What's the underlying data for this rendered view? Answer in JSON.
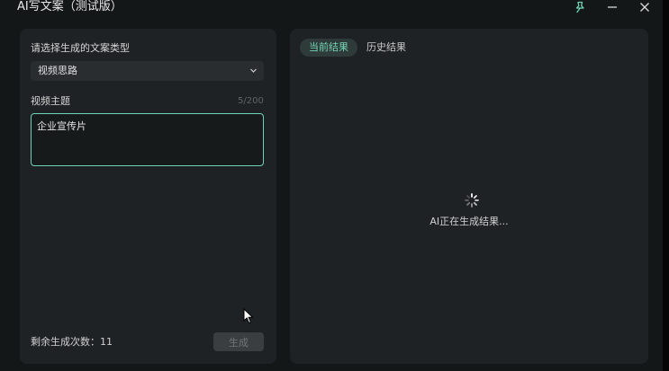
{
  "window": {
    "title": "AI写文案（测试版）"
  },
  "titlebar": {
    "pin_icon": "pin-icon",
    "minimize_icon": "minimize-icon",
    "close_icon": "close-icon"
  },
  "form": {
    "type_label": "请选择生成的文案类型",
    "type_selected": "视频思路",
    "topic_label": "视频主题",
    "topic_counter": "5/200",
    "topic_value": "企业宣传片",
    "remaining_label": "剩余生成次数：11",
    "generate_label": "生成"
  },
  "results": {
    "tabs": [
      {
        "label": "当前结果",
        "active": true
      },
      {
        "label": "历史结果",
        "active": false
      }
    ],
    "status_text": "AI正在生成结果..."
  },
  "colors": {
    "accent": "#6fd3b3",
    "panel": "#1f2224",
    "background": "#141718"
  }
}
